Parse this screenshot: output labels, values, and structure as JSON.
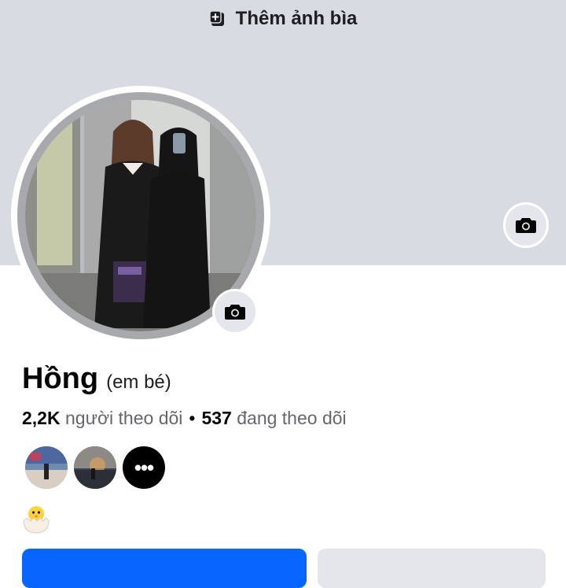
{
  "cover": {
    "add_cover_label": "Thêm ảnh bìa",
    "add_cover_icon": "add-photo-icon",
    "camera_icon": "camera-icon",
    "background": "#d8dbe1"
  },
  "profile": {
    "name": "Hồng",
    "nickname": "(em bé)",
    "followers_count": "2,2K",
    "followers_label": "người theo dõi",
    "separator": "•",
    "following_count": "537",
    "following_label": "đang theo dõi",
    "avatar_icon": "profile-photo",
    "avatar_camera_icon": "camera-icon"
  },
  "featured": {
    "items": [
      "story-thumbnail-1",
      "story-thumbnail-2"
    ],
    "more_label": "•••"
  },
  "bio": {
    "emoji_icon": "hatching-chick-icon"
  },
  "actions": {
    "primary_color": "#0866ff",
    "secondary_color": "#e4e6eb"
  }
}
